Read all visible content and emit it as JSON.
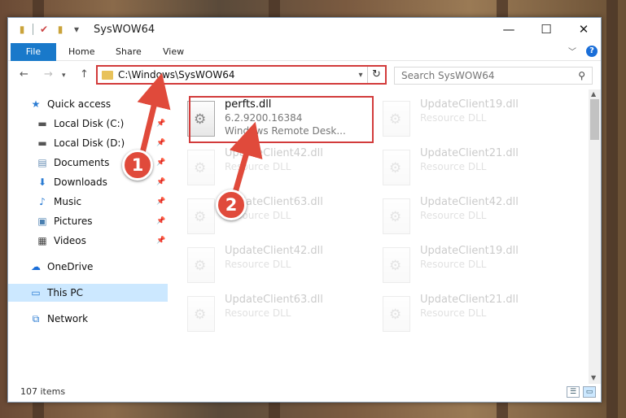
{
  "window": {
    "title": "SysWOW64",
    "controls": [
      "—",
      "☐",
      "✕"
    ]
  },
  "ribbon": {
    "tabs": [
      "File",
      "Home",
      "Share",
      "View"
    ]
  },
  "address": {
    "path": "C:\\Windows\\SysWOW64"
  },
  "search": {
    "placeholder": "Search SysWOW64"
  },
  "sidebar": {
    "items": [
      {
        "label": "Quick access",
        "icon": "star-icon",
        "pinned": false
      },
      {
        "label": "Local Disk (C:)",
        "icon": "drive-icon",
        "pinned": true
      },
      {
        "label": "Local Disk (D:)",
        "icon": "drive-icon",
        "pinned": true
      },
      {
        "label": "Documents",
        "icon": "documents-icon",
        "pinned": true
      },
      {
        "label": "Downloads",
        "icon": "download-icon",
        "pinned": true
      },
      {
        "label": "Music",
        "icon": "music-icon",
        "pinned": true
      },
      {
        "label": "Pictures",
        "icon": "pictures-icon",
        "pinned": true
      },
      {
        "label": "Videos",
        "icon": "videos-icon",
        "pinned": true
      },
      {
        "label": "OneDrive",
        "icon": "cloud-icon",
        "pinned": false
      },
      {
        "label": "This PC",
        "icon": "computer-icon",
        "pinned": false,
        "selected": true
      },
      {
        "label": "Network",
        "icon": "network-icon",
        "pinned": false
      }
    ]
  },
  "files": [
    {
      "name": "perfts.dll",
      "line1": "6.2.9200.16384",
      "line2": "Windows Remote Desk...",
      "highlighted": true
    },
    {
      "name": "UpdateClient19.dll",
      "line1": "Resource DLL"
    },
    {
      "name": "UpdateClient42.dll",
      "line1": "Resource DLL"
    },
    {
      "name": "UpdateClient21.dll",
      "line1": "Resource DLL"
    },
    {
      "name": "UpdateClient63.dll",
      "line1": "Resource DLL"
    },
    {
      "name": "UpdateClient42.dll",
      "line1": "Resource DLL"
    },
    {
      "name": "UpdateClient42.dll",
      "line1": "Resource DLL"
    },
    {
      "name": "UpdateClient19.dll",
      "line1": "Resource DLL"
    },
    {
      "name": "UpdateClient63.dll",
      "line1": "Resource DLL"
    },
    {
      "name": "UpdateClient21.dll",
      "line1": "Resource DLL"
    }
  ],
  "status": {
    "item_count": "107 items"
  },
  "annotations": {
    "step1": "1",
    "step2": "2",
    "color": "#e04a3b"
  }
}
